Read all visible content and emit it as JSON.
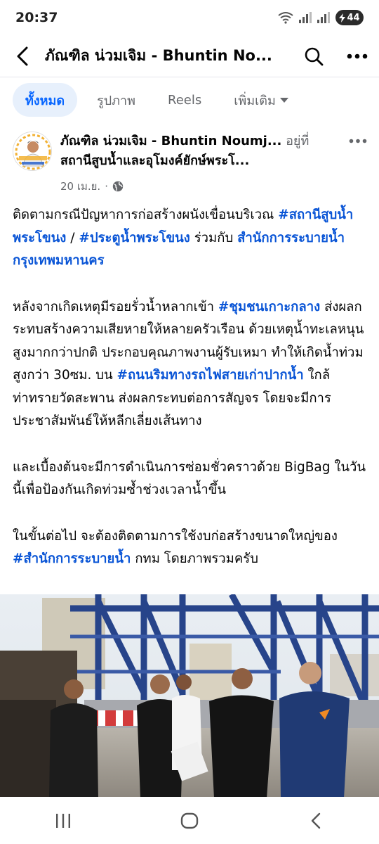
{
  "status_bar": {
    "time": "20:37",
    "battery": "44",
    "icons": [
      "wifi-icon",
      "signal-icon",
      "signal-icon",
      "battery-charging-icon"
    ]
  },
  "header": {
    "title": "ภัณฑิล น่วมเจิม - Bhuntin No...",
    "back_icon": "back-arrow-icon",
    "search_icon": "search-icon",
    "more_icon": "more-horizontal-icon"
  },
  "tabs": [
    {
      "label": "ทั้งหมด",
      "active": true
    },
    {
      "label": "รูปภาพ",
      "active": false
    },
    {
      "label": "Reels",
      "active": false
    },
    {
      "label": "เพิ่มเติม",
      "active": false
    }
  ],
  "post": {
    "author_line1": "ภัณฑิล น่วมเจิม - Bhuntin Noumj...",
    "author_suffix": " อยู่ที่",
    "author_line2": "สถานีสูบน้ำและอุโมงค์ยักษ์พระโ...",
    "date": "20 เม.ย.",
    "separator": "·",
    "privacy_icon": "globe-icon",
    "avatar_icon": "profile-avatar-icon",
    "more_icon": "more-horizontal-icon",
    "para1": {
      "t1": "ติดตามกรณีปัญหาการก่อสร้างผนังเขื่อนบริเวณ ",
      "tag1": "#สถานีสูบน้ำพระโขนง",
      "t2": " / ",
      "tag2": "#ประตูน้ำพระโขนง",
      "t3": " ร่วมกับ ",
      "tag3": "สำนักการระบายน้ำ กรุงเทพมหานคร"
    },
    "para2": {
      "t1": "หลังจากเกิดเหตุมีรอยรั่วน้ำหลากเข้า ",
      "tag1": "#ชุมชนเกาะกลาง",
      "t2": " ส่งผลกระทบสร้างความเสียหายให้หลายครัวเรือน ด้วยเหตุน้ำทะเลหนุนสูงมากกว่าปกติ ประกอบคุณภาพงานผู้รับเหมา ทำให้เกิดน้ำท่วมสูงกว่า 30ซม. บน ",
      "tag2": "#ถนนริมทางรถไฟสายเก่าปากน้ำ",
      "t3": " ใกล้ท่าทรายวัดสะพาน ส่งผลกระทบต่อการสัญจร โดยจะมีการประชาสัมพันธ์ให้หลีกเลี่ยงเส้นทาง"
    },
    "para3": "และเบื้องต้นจะมีการดำเนินการซ่อมชั่วคราวด้วย BigBag ในวันนี้เพื่อป้องกันเกิดท่วมซ้ำช่วงเวลาน้ำขึ้น",
    "para4": {
      "t1": "ในขั้นต่อไป จะต้องติดตามการใช้งบก่อสร้างขนาดใหญ่ของ ",
      "tag1": "#สำนักการระบายน้ำ",
      "t2": " กทม โดยภาพรวมครับ"
    }
  },
  "photo_icon": "post-photo",
  "nav_bar": {
    "recent_icon": "recent-apps-icon",
    "home_icon": "home-icon",
    "back_icon": "back-icon"
  },
  "colors": {
    "link": "#0a55d6",
    "tab_active_bg": "#e7f0fc",
    "tab_active_text": "#0866ff",
    "muted": "#65676b"
  }
}
